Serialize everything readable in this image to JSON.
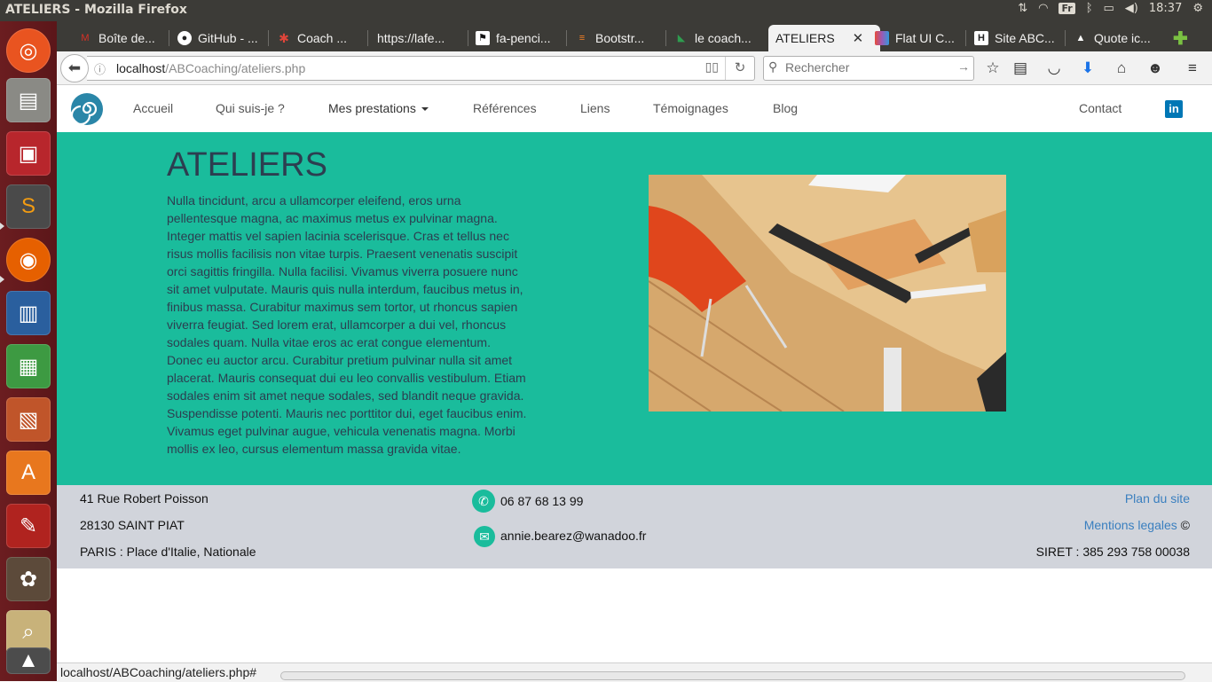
{
  "window": {
    "title": "ATELIERS - Mozilla Firefox"
  },
  "system": {
    "keyboard": "Fr",
    "time": "18:37"
  },
  "tabs": [
    {
      "label": "Boîte de...",
      "icon": "gmail-icon",
      "color": "#d93025"
    },
    {
      "label": "GitHub - ...",
      "icon": "github-icon",
      "color": "#222222"
    },
    {
      "label": "Coach ...",
      "icon": "star-icon",
      "color": "#e0453a"
    },
    {
      "label": "https://lafe...",
      "icon": "",
      "color": ""
    },
    {
      "label": "fa-penci...",
      "icon": "flag-icon",
      "color": "#111111"
    },
    {
      "label": "Bootstr...",
      "icon": "stackoverflow-icon",
      "color": "#f48024"
    },
    {
      "label": "le coach...",
      "icon": "bookmark-icon",
      "color": "#2e9c4f"
    },
    {
      "label": "ATELIERS",
      "icon": "",
      "color": "",
      "active": true
    },
    {
      "label": "Flat UI C...",
      "icon": "palette-icon",
      "color": "#9b59b6"
    },
    {
      "label": "Site ABC...",
      "icon": "h-icon",
      "color": "#ffffff"
    },
    {
      "label": "Quote ic...",
      "icon": "quote-icon",
      "color": "#222222"
    }
  ],
  "address": {
    "host": "localhost",
    "path": "/ABCoaching/ateliers.php"
  },
  "search": {
    "placeholder": "Rechercher"
  },
  "site": {
    "nav": {
      "items": [
        "Accueil",
        "Qui suis-je ?",
        "Mes prestations",
        "Références",
        "Liens",
        "Témoignages",
        "Blog"
      ],
      "contact": "Contact",
      "linkedin": "in"
    },
    "hero": {
      "title": "ATELIERS",
      "text": "Nulla tincidunt, arcu a ullamcorper eleifend, eros urna pellentesque magna, ac maximus metus ex pulvinar magna. Integer mattis vel sapien lacinia scelerisque. Cras et tellus nec risus mollis facilisis non vitae turpis. Praesent venenatis suscipit orci sagittis fringilla. Nulla facilisi. Vivamus viverra posuere nunc sit amet vulputate. Mauris quis nulla interdum, faucibus metus in, finibus massa. Curabitur maximus sem tortor, ut rhoncus sapien viverra feugiat. Sed lorem erat, ullamcorper a dui vel, rhoncus sodales quam. Nulla vitae eros ac erat congue elementum. Donec eu auctor arcu. Curabitur pretium pulvinar nulla sit amet placerat. Mauris consequat dui eu leo convallis vestibulum. Etiam sodales enim sit amet neque sodales, sed blandit neque gravida. Suspendisse potenti. Mauris nec porttitor dui, eget faucibus enim. Vivamus eget pulvinar augue, vehicula venenatis magna. Morbi mollis ex leo, cursus elementum massa gravida vitae."
    },
    "footer": {
      "address1": "41 Rue Robert Poisson",
      "address2": "28130 SAINT PIAT",
      "address3": "PARIS : Place d'Italie, Nationale",
      "phone": "06 87 68 13 99",
      "email": "annie.bearez@wanadoo.fr",
      "sitemap": "Plan du site",
      "legal": "Mentions legales",
      "copyright": "©",
      "siret": "SIRET : 385 293 758 00038"
    }
  },
  "status": {
    "text": "localhost/ABCoaching/ateliers.php#"
  },
  "colors": {
    "accent": "#1abc9c",
    "footer": "#d1d4db",
    "link": "#3a7fbf"
  }
}
